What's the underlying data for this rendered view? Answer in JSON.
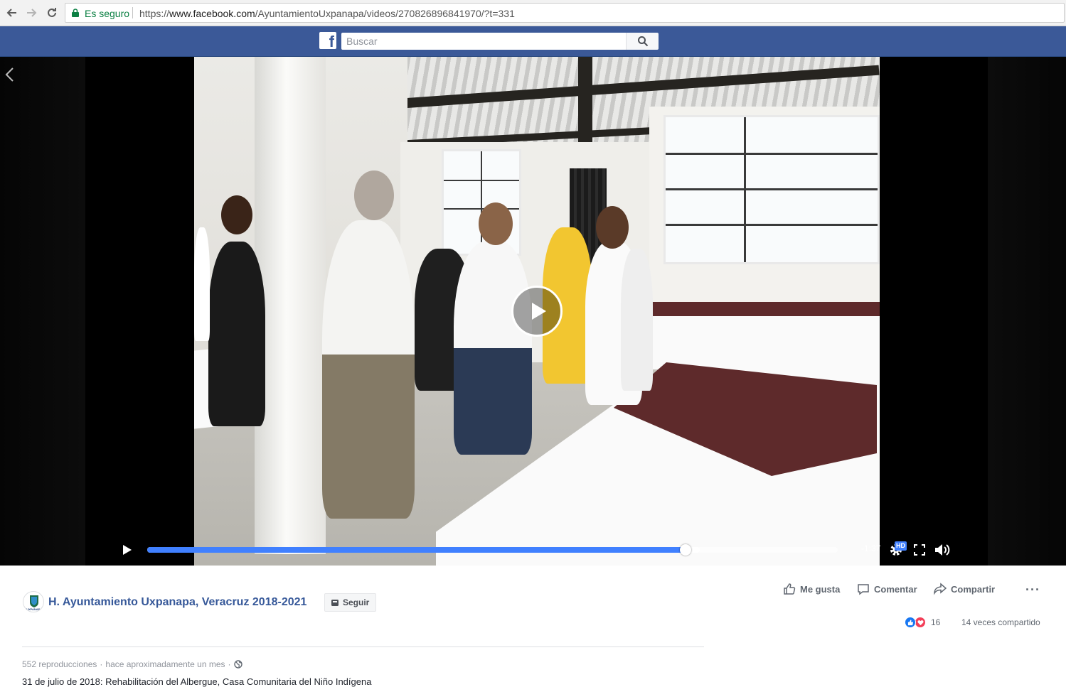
{
  "browser": {
    "secure_label": "Es seguro",
    "url_scheme": "https://",
    "url_host": "www.facebook.com",
    "url_path": "/AyuntamientoUxpanapa/videos/270826896841970/?t=331"
  },
  "header": {
    "logo_letter": "f",
    "search_placeholder": "Buscar"
  },
  "video": {
    "remaining_time": "-1:37",
    "quality_badge": "HD",
    "progress_fraction": 0.78,
    "buffered_fraction": 0.8,
    "accent_color": "#4080ff"
  },
  "post": {
    "page_name": "H. Ayuntamiento Uxpanapa, Veracruz 2018-2021",
    "avatar_label": "UXPANAPA",
    "follow_label": "Seguir",
    "actions": {
      "like": "Me gusta",
      "comment": "Comentar",
      "share": "Compartir"
    },
    "reaction_count": "16",
    "shares": "14 veces compartido",
    "views": "552 reproducciones",
    "separator": "·",
    "posted": "hace aproximadamente un mes",
    "description": "31 de julio de 2018: Rehabilitación del Albergue, Casa Comunitaria del Niño Indígena"
  },
  "colors": {
    "facebook_blue": "#3b5998",
    "link_blue": "#365899",
    "like_blue": "#1877f2",
    "love_red": "#f33e58"
  }
}
